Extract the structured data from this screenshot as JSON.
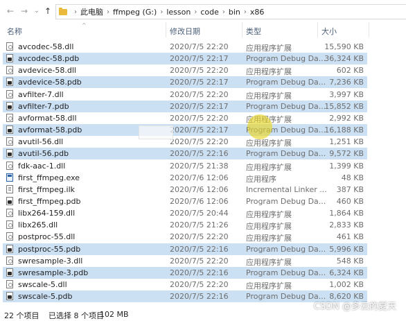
{
  "nav": {
    "back": "←",
    "forward": "→",
    "dropdown": "⌄",
    "up": "↑"
  },
  "breadcrumb": [
    "此电脑",
    "ffmpeg (G:)",
    "lesson",
    "code",
    "bin",
    "x86"
  ],
  "columns": {
    "name": "名称",
    "date": "修改日期",
    "type": "类型",
    "size": "大小"
  },
  "files": [
    {
      "name": "avcodec-58.dll",
      "date": "2020/7/5 22:20",
      "type": "应用程序扩展",
      "size": "15,590 KB",
      "icon": "dll",
      "selected": false
    },
    {
      "name": "avcodec-58.pdb",
      "date": "2020/7/5 22:17",
      "type": "Program Debug Da...",
      "size": "36,324 KB",
      "icon": "pdb",
      "selected": true
    },
    {
      "name": "avdevice-58.dll",
      "date": "2020/7/5 22:20",
      "type": "应用程序扩展",
      "size": "602 KB",
      "icon": "dll",
      "selected": false
    },
    {
      "name": "avdevice-58.pdb",
      "date": "2020/7/5 22:17",
      "type": "Program Debug Da...",
      "size": "7,236 KB",
      "icon": "pdb",
      "selected": true
    },
    {
      "name": "avfilter-7.dll",
      "date": "2020/7/5 22:20",
      "type": "应用程序扩展",
      "size": "3,997 KB",
      "icon": "dll",
      "selected": false
    },
    {
      "name": "avfilter-7.pdb",
      "date": "2020/7/5 22:17",
      "type": "Program Debug Da...",
      "size": "15,852 KB",
      "icon": "pdb",
      "selected": true
    },
    {
      "name": "avformat-58.dll",
      "date": "2020/7/5 22:20",
      "type": "应用程序扩展",
      "size": "2,992 KB",
      "icon": "dll",
      "selected": false
    },
    {
      "name": "avformat-58.pdb",
      "date": "2020/7/5 22:17",
      "type": "Program Debug Da...",
      "size": "16,188 KB",
      "icon": "pdb",
      "selected": true
    },
    {
      "name": "avutil-56.dll",
      "date": "2020/7/5 22:20",
      "type": "应用程序扩展",
      "size": "1,251 KB",
      "icon": "dll",
      "selected": false
    },
    {
      "name": "avutil-56.pdb",
      "date": "2020/7/5 22:16",
      "type": "Program Debug Da...",
      "size": "9,572 KB",
      "icon": "pdb",
      "selected": true
    },
    {
      "name": "fdk-aac-1.dll",
      "date": "2020/7/5 21:38",
      "type": "应用程序扩展",
      "size": "1,399 KB",
      "icon": "dll",
      "selected": false
    },
    {
      "name": "first_ffmpeg.exe",
      "date": "2020/7/6 12:06",
      "type": "应用程序",
      "size": "48 KB",
      "icon": "exe",
      "selected": false
    },
    {
      "name": "first_ffmpeg.ilk",
      "date": "2020/7/6 12:06",
      "type": "Incremental Linker ...",
      "size": "387 KB",
      "icon": "ilk",
      "selected": false
    },
    {
      "name": "first_ffmpeg.pdb",
      "date": "2020/7/6 12:06",
      "type": "Program Debug Da...",
      "size": "460 KB",
      "icon": "pdb",
      "selected": false
    },
    {
      "name": "libx264-159.dll",
      "date": "2020/7/5 20:44",
      "type": "应用程序扩展",
      "size": "1,864 KB",
      "icon": "dll",
      "selected": false
    },
    {
      "name": "libx265.dll",
      "date": "2020/7/5 21:26",
      "type": "应用程序扩展",
      "size": "2,833 KB",
      "icon": "dll",
      "selected": false
    },
    {
      "name": "postproc-55.dll",
      "date": "2020/7/5 22:20",
      "type": "应用程序扩展",
      "size": "461 KB",
      "icon": "dll",
      "selected": false
    },
    {
      "name": "postproc-55.pdb",
      "date": "2020/7/5 22:16",
      "type": "Program Debug Da...",
      "size": "5,996 KB",
      "icon": "pdb",
      "selected": true
    },
    {
      "name": "swresample-3.dll",
      "date": "2020/7/5 22:20",
      "type": "应用程序扩展",
      "size": "548 KB",
      "icon": "dll",
      "selected": false
    },
    {
      "name": "swresample-3.pdb",
      "date": "2020/7/5 22:16",
      "type": "Program Debug Da...",
      "size": "6,324 KB",
      "icon": "pdb",
      "selected": true
    },
    {
      "name": "swscale-5.dll",
      "date": "2020/7/5 22:20",
      "type": "应用程序扩展",
      "size": "1,002 KB",
      "icon": "dll",
      "selected": false
    },
    {
      "name": "swscale-5.pdb",
      "date": "2020/7/5 22:16",
      "type": "Program Debug Da...",
      "size": "8,620 KB",
      "icon": "pdb",
      "selected": true
    }
  ],
  "status": {
    "count": "22 个项目",
    "selected": "已选择 8 个项目",
    "size": "102 MB"
  },
  "watermark": "CSDN @多云的夏天",
  "colors": {
    "selection": "#cce0f4",
    "header_text": "#4c607a",
    "cursor_highlight": "#e6d628"
  }
}
